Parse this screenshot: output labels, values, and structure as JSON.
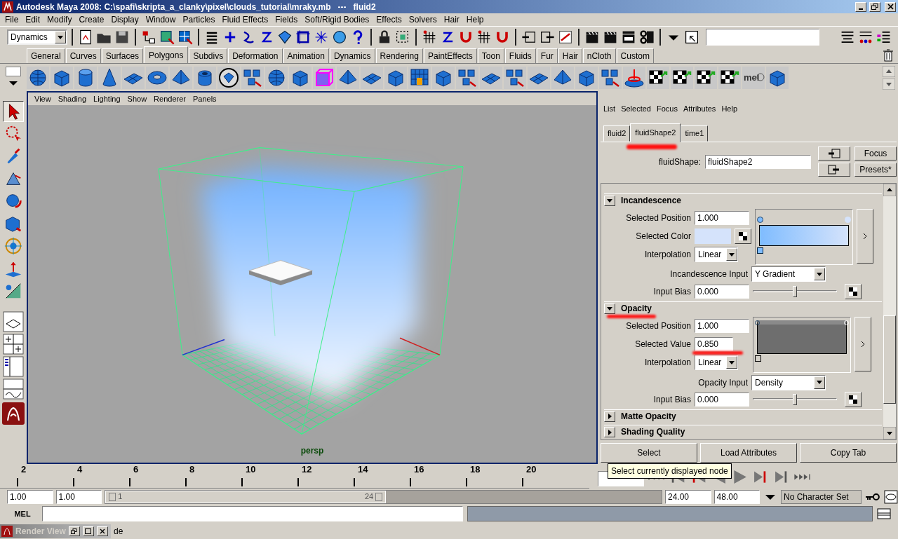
{
  "window": {
    "title": "Autodesk Maya 2008: C:\\spafi\\skripta_a_clanky\\pixel\\clouds_tutorial\\mraky.mb   ---   fluid2"
  },
  "menu": [
    "File",
    "Edit",
    "Modify",
    "Create",
    "Display",
    "Window",
    "Particles",
    "Fluid Effects",
    "Fields",
    "Soft/Rigid Bodies",
    "Effects",
    "Solvers",
    "Hair",
    "Help"
  ],
  "status_line": {
    "mode": "Dynamics"
  },
  "shelf_tabs": [
    {
      "label": "General",
      "selected": false
    },
    {
      "label": "Curves",
      "selected": false
    },
    {
      "label": "Surfaces",
      "selected": false
    },
    {
      "label": "Polygons",
      "selected": true
    },
    {
      "label": "Subdivs",
      "selected": false
    },
    {
      "label": "Deformation",
      "selected": false
    },
    {
      "label": "Animation",
      "selected": false
    },
    {
      "label": "Dynamics",
      "selected": false
    },
    {
      "label": "Rendering",
      "selected": false
    },
    {
      "label": "PaintEffects",
      "selected": false
    },
    {
      "label": "Toon",
      "selected": false
    },
    {
      "label": "Fluids",
      "selected": false
    },
    {
      "label": "Fur",
      "selected": false
    },
    {
      "label": "Hair",
      "selected": false
    },
    {
      "label": "nCloth",
      "selected": false
    },
    {
      "label": "Custom",
      "selected": false
    }
  ],
  "shelf": [
    {
      "kind": "sphere"
    },
    {
      "kind": "cube"
    },
    {
      "kind": "cylinder"
    },
    {
      "kind": "cone"
    },
    {
      "kind": "plane"
    },
    {
      "kind": "torus"
    },
    {
      "kind": "pyramid"
    },
    {
      "kind": "pipe"
    },
    {
      "kind": "circled"
    },
    {
      "kind": "tiles"
    },
    {
      "kind": "sphere"
    },
    {
      "kind": "cube"
    },
    {
      "kind": "wirecube"
    },
    {
      "kind": "pyramid"
    },
    {
      "kind": "plane"
    },
    {
      "kind": "cube"
    },
    {
      "kind": "grid"
    },
    {
      "kind": "cube"
    },
    {
      "kind": "tiles"
    },
    {
      "kind": "plane"
    },
    {
      "kind": "tiles"
    },
    {
      "kind": "plane"
    },
    {
      "kind": "pyramid"
    },
    {
      "kind": "cube"
    },
    {
      "kind": "tiles"
    },
    {
      "kind": "disc"
    },
    {
      "kind": "checker"
    },
    {
      "kind": "checker"
    },
    {
      "kind": "checker"
    },
    {
      "kind": "checker"
    },
    {
      "kind": "mel",
      "label": "mel"
    },
    {
      "kind": "cube"
    }
  ],
  "viewport": {
    "menu": [
      "View",
      "Shading",
      "Lighting",
      "Show",
      "Renderer",
      "Panels"
    ],
    "camera": "persp"
  },
  "attribute_editor": {
    "menu": [
      "List",
      "Selected",
      "Focus",
      "Attributes",
      "Help"
    ],
    "tabs": [
      {
        "label": "fluid2",
        "selected": false,
        "marked": false
      },
      {
        "label": "fluidShape2",
        "selected": true,
        "marked": true
      },
      {
        "label": "time1",
        "selected": false,
        "marked": false
      }
    ],
    "node_label": "fluidShape:",
    "node_name": "fluidShape2",
    "buttons": [
      "Focus",
      "Presets*"
    ],
    "sections": [
      {
        "title": "Incandescence",
        "expanded": true,
        "marked": false,
        "ramp": {
          "kind": "color"
        },
        "ramp_rows": [
          {
            "kind": "field",
            "label": "Selected Position",
            "value": "1.000",
            "marked": false
          },
          {
            "kind": "color",
            "label": "Selected Color",
            "color": "#d5e3fb",
            "marked": false
          },
          {
            "kind": "dropdown",
            "label": "Interpolation",
            "value": "Linear",
            "marked": false
          }
        ],
        "rows": [
          {
            "kind": "dropdown",
            "label": "Incandescence Input",
            "value": "Y Gradient"
          },
          {
            "kind": "slider",
            "label": "Input Bias",
            "value": "0.000",
            "level": 0.5
          }
        ]
      },
      {
        "title": "Opacity",
        "expanded": true,
        "marked": true,
        "ramp": {
          "kind": "value"
        },
        "ramp_rows": [
          {
            "kind": "field",
            "label": "Selected Position",
            "value": "1.000",
            "marked": false
          },
          {
            "kind": "field",
            "label": "Selected Value",
            "value": "0.850",
            "marked": true
          },
          {
            "kind": "dropdown",
            "label": "Interpolation",
            "value": "Linear",
            "marked": false
          }
        ],
        "rows": [
          {
            "kind": "dropdown",
            "label": "Opacity Input",
            "value": "Density"
          },
          {
            "kind": "slider",
            "label": "Input Bias",
            "value": "0.000",
            "level": 0.5
          }
        ]
      },
      {
        "title": "Matte Opacity",
        "expanded": false,
        "marked": false
      },
      {
        "title": "Shading Quality",
        "expanded": false,
        "marked": false
      }
    ],
    "bottom_buttons": [
      "Select",
      "Load Attributes",
      "Copy Tab"
    ]
  },
  "tooltip": "Select currently displayed node",
  "time_slider": {
    "ticks": [
      "2",
      "4",
      "6",
      "8",
      "10",
      "12",
      "14",
      "16",
      "18",
      "20"
    ]
  },
  "range_slider": {
    "start": "1.00",
    "range_start": "1.00",
    "range_min_label": "1",
    "range_max_label": "24",
    "range_end": "24.00",
    "end": "48.00",
    "character_set": "No Character Set"
  },
  "command_line": {
    "label": "MEL"
  },
  "help_line": {
    "text": "de"
  },
  "minimized_window": {
    "title": "Render View"
  }
}
